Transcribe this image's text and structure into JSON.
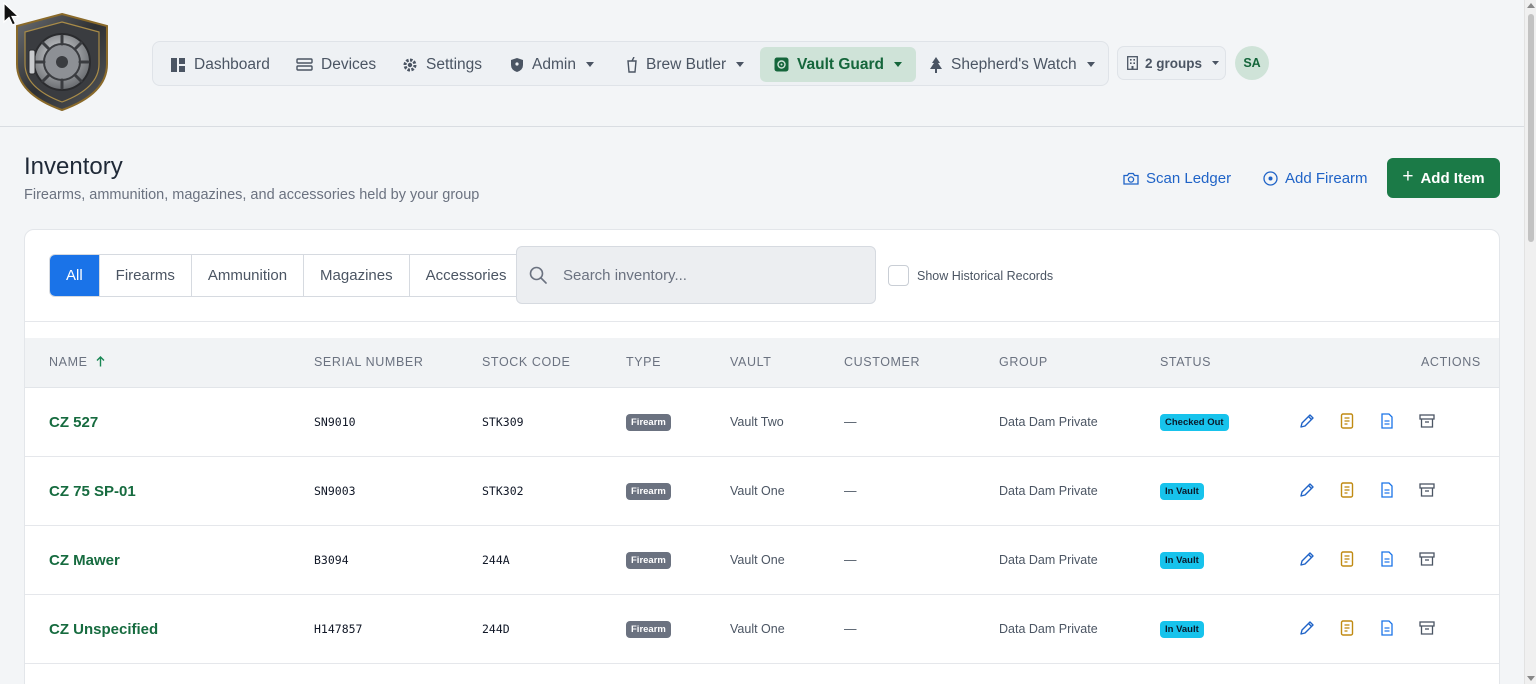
{
  "nav": {
    "items": [
      {
        "label": "Dashboard"
      },
      {
        "label": "Devices"
      },
      {
        "label": "Settings"
      },
      {
        "label": "Admin"
      },
      {
        "label": "Brew Butler"
      },
      {
        "label": "Vault Guard"
      },
      {
        "label": "Shepherd's Watch"
      }
    ],
    "groups_label": "2 groups",
    "avatar_initials": "SA",
    "active_color": "#15663b"
  },
  "page": {
    "title": "Inventory",
    "subtitle": "Firearms, ammunition, magazines, and accessories held by your group",
    "scan_ledger": "Scan Ledger",
    "add_firearm": "Add Firearm",
    "add_item": "Add Item"
  },
  "filters": {
    "tabs": [
      "All",
      "Firearms",
      "Ammunition",
      "Magazines",
      "Accessories"
    ],
    "active_tab": "All",
    "search_placeholder": "Search inventory...",
    "search_value": "",
    "historical_label": "Show Historical Records",
    "historical_checked": false
  },
  "table": {
    "columns": [
      "NAME",
      "SERIAL NUMBER",
      "STOCK CODE",
      "TYPE",
      "VAULT",
      "CUSTOMER",
      "GROUP",
      "STATUS",
      "ACTIONS"
    ],
    "sort": {
      "column": "NAME",
      "direction": "ascending"
    },
    "rows": [
      {
        "name": "CZ 527",
        "serial": "SN9010",
        "stock": "STK309",
        "type": "Firearm",
        "vault": "Vault Two",
        "customer": "—",
        "group": "Data Dam Private",
        "status": "Checked Out"
      },
      {
        "name": "CZ 75 SP-01",
        "serial": "SN9003",
        "stock": "STK302",
        "type": "Firearm",
        "vault": "Vault One",
        "customer": "—",
        "group": "Data Dam Private",
        "status": "In Vault"
      },
      {
        "name": "CZ Mawer",
        "serial": "B3094",
        "stock": "244A",
        "type": "Firearm",
        "vault": "Vault One",
        "customer": "—",
        "group": "Data Dam Private",
        "status": "In Vault"
      },
      {
        "name": "CZ Unspecified",
        "serial": "H147857",
        "stock": "244D",
        "type": "Firearm",
        "vault": "Vault One",
        "customer": "—",
        "group": "Data Dam Private",
        "status": "In Vault"
      }
    ],
    "row_actions": [
      "pencil-icon",
      "ledger-icon",
      "document-icon",
      "archive-icon"
    ]
  },
  "colors": {
    "brand_green": "#1b7a47",
    "link_blue": "#1f63c7",
    "tab_active": "#1a73e8",
    "status_cyan": "#17c3ec",
    "type_gray": "#6b7280"
  }
}
